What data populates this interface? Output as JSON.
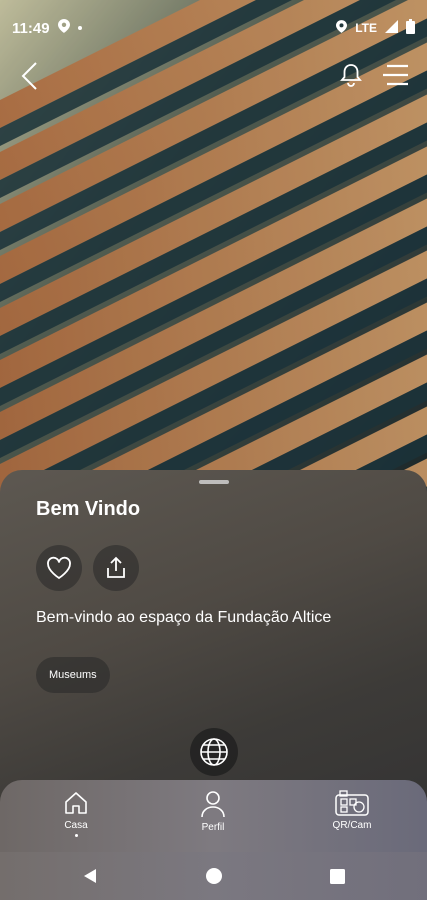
{
  "status_bar": {
    "time": "11:49",
    "network": "LTE"
  },
  "hero": {
    "image_subject": "building-facade-photo"
  },
  "content": {
    "title": "Bem Vindo",
    "description": "Bem-vindo ao espaço da Fundação Altice",
    "tag": "Museums"
  },
  "bottom_nav": {
    "items": [
      {
        "label": "Casa",
        "icon": "home-icon",
        "active": true
      },
      {
        "label": "Perfil",
        "icon": "person-icon",
        "active": false
      },
      {
        "label": "QR/Cam",
        "icon": "qr-camera-icon",
        "active": false
      }
    ]
  },
  "colors": {
    "sheet": "#4f4a44",
    "nav": "#7e7a80",
    "facade": "#d79a5c"
  }
}
